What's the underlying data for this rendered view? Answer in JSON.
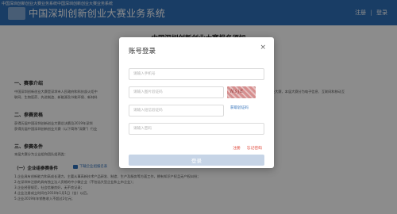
{
  "browser": {
    "tab_title": "中国深圳创新创业大赛业务系统中国深圳创新创业大赛业务系统"
  },
  "header": {
    "system_name": "中国深圳创新创业大赛业务系统",
    "register_link": "注册",
    "separator": "|",
    "login_link": "登录"
  },
  "page": {
    "title": "中国深圳创新创业大赛报名须知",
    "section1_heading": "一、赛事介绍",
    "section1_text_line1": "中国深圳创新创业大赛是深圳市人民政府和科技部火炬中",
    "section1_text_line2": "联网、生物医药、先进制造、新能源及节能环保、新材料",
    "section1_text_right": "业大赛，本届大赛分为电子信息、互联网和移动互",
    "section2_heading": "二、参赛资格",
    "section2_text_line1": "获得历届中国深圳创新创业大赛总决赛及2019年深圳",
    "section2_text_line2": "获得历届中国深圳创新创业大赛（以下简称\"深赛\"）行业",
    "section3_heading": "三、参赛条件",
    "section3_text": "本届大赛分为企业组和团队组两类：",
    "subsection_heading": "（一）企业组参赛条件",
    "download_link": "下载企业组报名表",
    "cond1": "1.企业具有创新能力和高成长潜力，主要从事高新技术产品研发、制造、生产及服务等方面工作，拥有知识产权且无产权纠纷；",
    "cond2": "2.在深圳市注册的具有独立法人资格的中小微企业（不包括大型企业和上市企业）；",
    "cond3": "3.企业经营规范，社会信誉良好，无不良记录；",
    "cond4": "4.企业注册成立时间在2010年1月1日（含）以后。",
    "cond5": "5.企业2019年年销售收入不超过2亿元；"
  },
  "login_modal": {
    "title": "账号登录",
    "close_icon": "close-icon",
    "account_placeholder": "请输入手机号",
    "captcha_placeholder": "请输入图片验证码",
    "captcha_image_text": "NsjE",
    "sms_placeholder": "请输入短信验证码",
    "sms_button": "获取验证码",
    "password_placeholder": "请输入密码",
    "register_link": "注册",
    "forgot_link": "忘记密码",
    "login_button": "登录"
  },
  "colors": {
    "header_bg": "#2f6fb9",
    "link_blue": "#2f6fb9",
    "link_red": "#e0483a",
    "login_button_disabled": "#c6d4e6"
  }
}
